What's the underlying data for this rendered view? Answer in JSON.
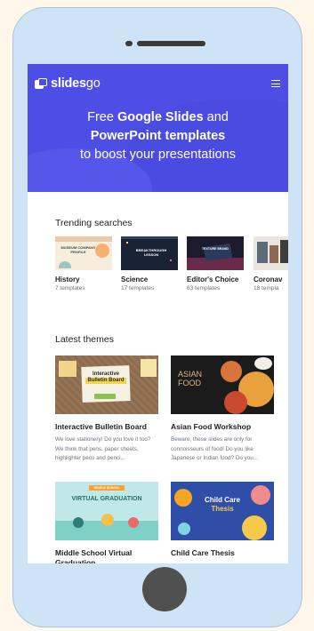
{
  "brand": {
    "name_bold": "slides",
    "name_light": "go"
  },
  "hero": {
    "line1_prefix": "Free ",
    "line1_bold": "Google Slides",
    "line1_suffix": " and",
    "line2_bold": "PowerPoint templates",
    "line3": "to boost your presentations"
  },
  "trending": {
    "title": "Trending searches",
    "items": [
      {
        "name": "History",
        "count": "7 templates",
        "thumb_text": "MUSEUM COMPANY PROFILE"
      },
      {
        "name": "Science",
        "count": "17 templates",
        "thumb_text": "BREAKTHROUGH LESSON"
      },
      {
        "name": "Editor's Choice",
        "count": "63 templates",
        "thumb_text": "TEXTURE BRAND"
      },
      {
        "name": "Coronav",
        "count": "18 templa",
        "thumb_text": ""
      }
    ]
  },
  "latest": {
    "title": "Latest themes",
    "items": [
      {
        "title": "Interactive Bulletin Board",
        "desc": "We love stationery! Do you love it too? We think that pens, paper sheets, highlighter pens and penci...",
        "thumb_line1": "Interactive",
        "thumb_line2": "Bulletin Board"
      },
      {
        "title": "Asian Food Workshop",
        "desc": "Beware, these slides are only for connoisseurs of food! Do you like Japanese or Indian food? Do you...",
        "thumb_line1": "ASIAN",
        "thumb_line2": "FOOD"
      },
      {
        "title": "Middle School Virtual Graduation",
        "desc": "",
        "thumb_line1": "MIDDLE SCHOOL",
        "thumb_line2": "VIRTUAL GRADUATION"
      },
      {
        "title": "Child Care Thesis",
        "desc": "",
        "thumb_line1": "Child Care",
        "thumb_line2": "Thesis"
      }
    ]
  },
  "colors": {
    "hero": "#4d4ee6",
    "phone": "#cfe3f6",
    "background": "#fff8ea"
  }
}
